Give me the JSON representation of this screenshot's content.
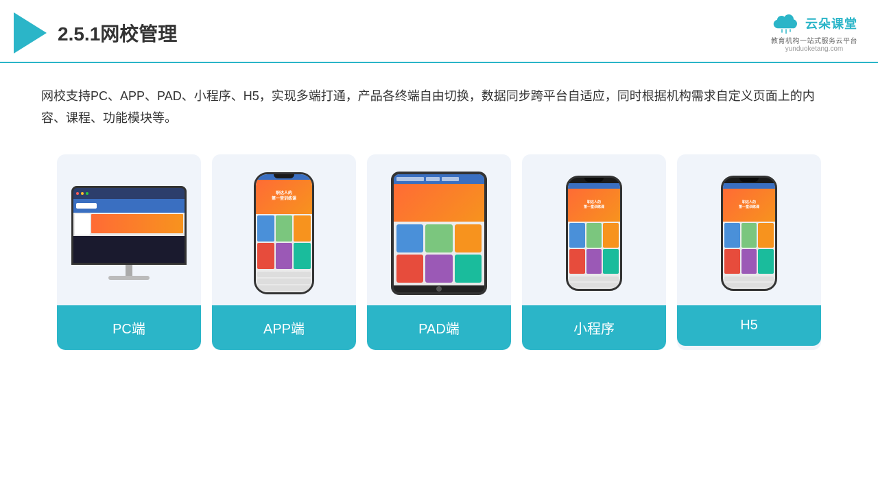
{
  "header": {
    "title": "2.5.1网校管理",
    "brand_name": "云朵课堂",
    "brand_url": "yunduoketang.com",
    "brand_tagline": "教育机构一站\n式服务云平台"
  },
  "description": "网校支持PC、APP、PAD、小程序、H5，实现多端打通，产品各终端自由切换，数据同步跨平台自适应，同时根据机构需求自定义页面上的内容、课程、功能模块等。",
  "cards": [
    {
      "id": "pc",
      "label": "PC端"
    },
    {
      "id": "app",
      "label": "APP端"
    },
    {
      "id": "pad",
      "label": "PAD端"
    },
    {
      "id": "miniprogram",
      "label": "小程序"
    },
    {
      "id": "h5",
      "label": "H5"
    }
  ],
  "accent_color": "#2bb5c8",
  "phone_hero_text": "职达人的\n第一堂训练课",
  "mini_hero_text": "职达人的\n第一堂训练课"
}
